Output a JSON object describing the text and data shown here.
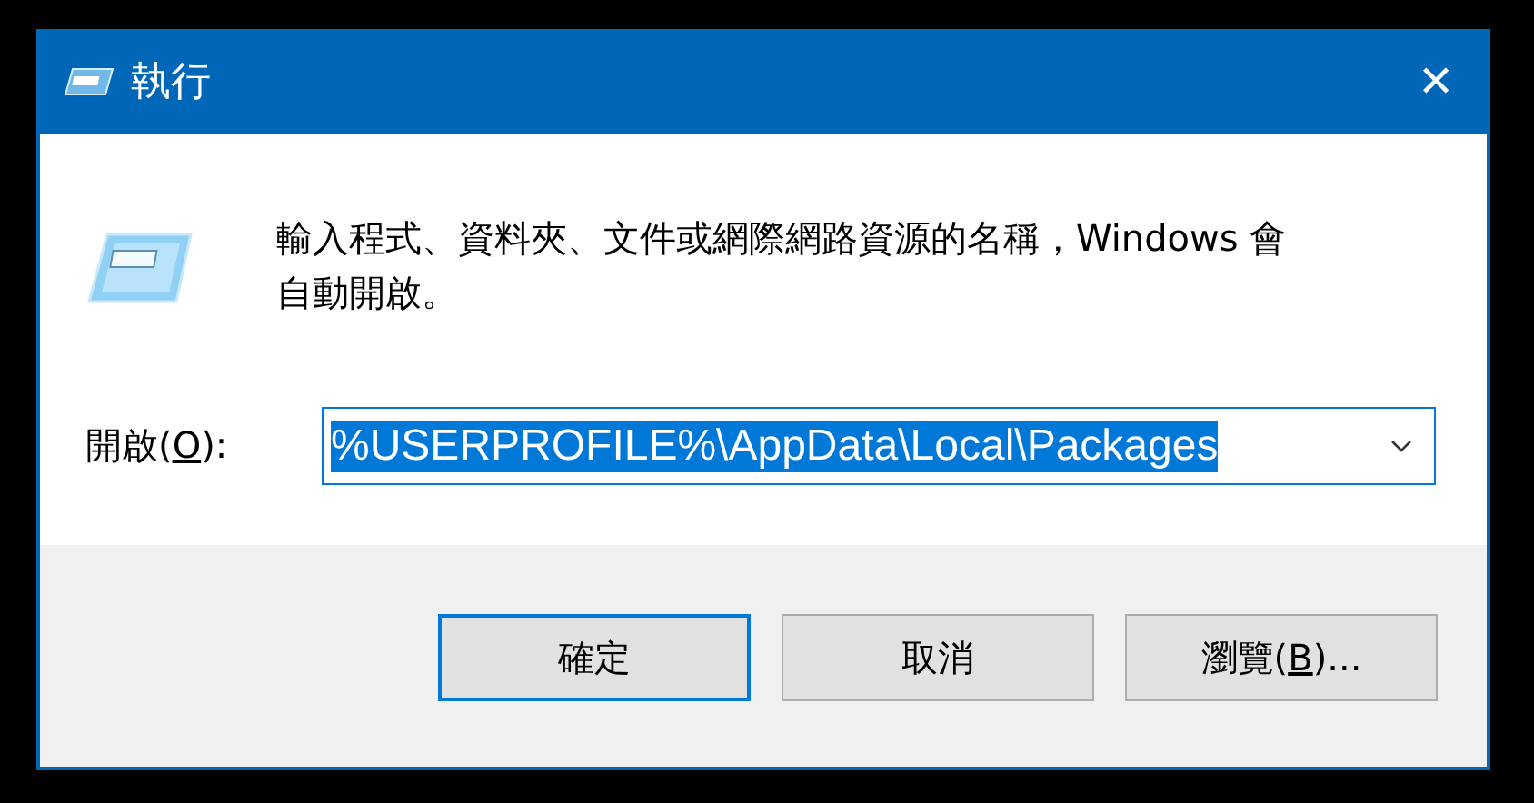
{
  "window": {
    "title": "執行",
    "close": "✕"
  },
  "description": "輸入程式、資料夾、文件或網際網路資源的名稱，Windows 會自動開啟。",
  "open_field": {
    "label": {
      "before": "開啟(",
      "key": "O",
      "after": "):"
    },
    "value": "%USERPROFILE%\\AppData\\Local\\Packages",
    "selected_text": true
  },
  "buttons": [
    {
      "label": {
        "before": "確定"
      },
      "default": true
    },
    {
      "label": {
        "before": "取消"
      },
      "default": false
    },
    {
      "label": {
        "before": "瀏覽(",
        "key": "B",
        "after": ")..."
      },
      "default": false
    }
  ]
}
